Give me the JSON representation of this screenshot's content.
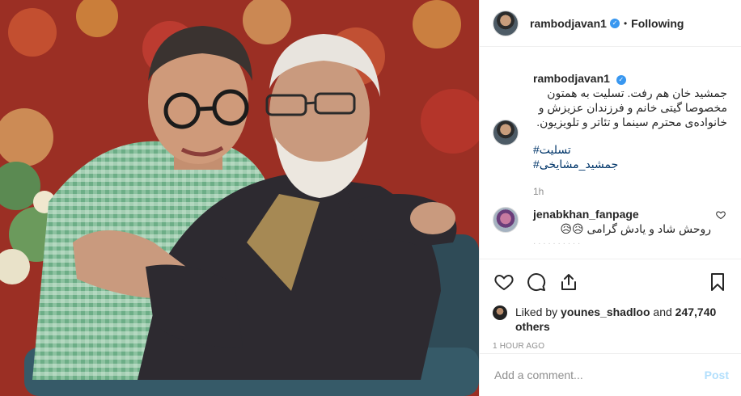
{
  "post": {
    "photo_alt": "",
    "author": {
      "username": "rambodjavan1",
      "verified": true,
      "follow_status": "Following",
      "separator": "•"
    },
    "caption": {
      "username": "rambodjavan1",
      "text": "جمشید خان هم رفت. تسلیت به همتون مخصوصا گیتی خانم و فرزندان عزیزش و خانواده‌ی محترم سینما و تئاتر و تلویزیون.",
      "hashtags": [
        "#تسلیت",
        "#جمشید_مشایخی"
      ],
      "time": "1h"
    },
    "comments": [
      {
        "username": "jenabkhan_fanpage",
        "text": "روحش شاد و یادش گرامی 😥😥",
        "icon": "heart-outline-icon"
      }
    ],
    "actions": {
      "like_icon": "heart-icon",
      "comment_icon": "comment-icon",
      "share_icon": "share-icon",
      "save_icon": "bookmark-icon"
    },
    "likes": {
      "prefix": "Liked by",
      "liker": "younes_shadloo",
      "conjunction": "and",
      "others": "247,740 others"
    },
    "timestamp": "1 HOUR AGO",
    "comment_box": {
      "placeholder": "Add a comment...",
      "post_label": "Post"
    }
  },
  "colors": {
    "link": "#003569",
    "verified": "#3897f0",
    "post_disabled": "#b2dffc",
    "muted": "#8e8e8e"
  }
}
